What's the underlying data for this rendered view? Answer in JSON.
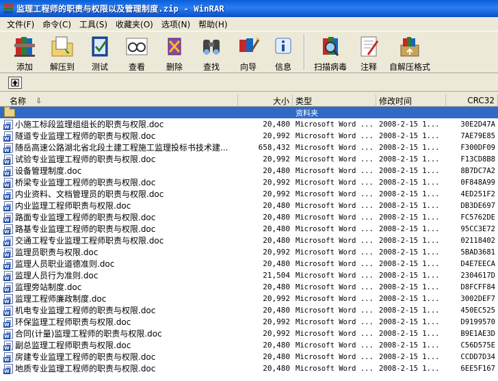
{
  "window": {
    "title": "监理工程师的职责与权限以及管理制度.zip - WinRAR"
  },
  "menu": [
    {
      "label": "文件(F)"
    },
    {
      "label": "命令(C)"
    },
    {
      "label": "工具(S)"
    },
    {
      "label": "收藏夹(O)"
    },
    {
      "label": "选项(N)"
    },
    {
      "label": "帮助(H)"
    }
  ],
  "toolbar": {
    "buttons": [
      {
        "label": "添加",
        "icon": "add-books-icon"
      },
      {
        "label": "解压到",
        "icon": "extract-folder-icon"
      },
      {
        "label": "测试",
        "icon": "test-check-icon"
      },
      {
        "label": "查看",
        "icon": "view-glasses-icon"
      },
      {
        "label": "删除",
        "icon": "delete-book-icon"
      },
      {
        "label": "查找",
        "icon": "find-binoculars-icon"
      },
      {
        "label": "向导",
        "icon": "wizard-icon"
      },
      {
        "label": "信息",
        "icon": "info-icon"
      },
      {
        "label": "扫描病毒",
        "icon": "virus-scan-icon"
      },
      {
        "label": "注释",
        "icon": "comment-icon"
      },
      {
        "label": "自解压格式",
        "icon": "sfx-icon"
      }
    ]
  },
  "columns": {
    "name": "名称",
    "size": "大小",
    "type": "类型",
    "date": "修改时间",
    "crc": "CRC32"
  },
  "folder_row": {
    "name": "..",
    "type": "资料夹"
  },
  "files": [
    {
      "name": "小施工标段监理组组长的职责与权限.doc",
      "size": "20,480",
      "type": "Microsoft Word ...",
      "date": "2008-2-15 1...",
      "crc": "30E2D47A"
    },
    {
      "name": "隧道专业监理工程师的职责与权限.doc",
      "size": "20,992",
      "type": "Microsoft Word ...",
      "date": "2008-2-15 1...",
      "crc": "7AE79E85"
    },
    {
      "name": "随岳高速公路湖北省北段土建工程施工监理投标书技术建...",
      "size": "658,432",
      "type": "Microsoft Word ...",
      "date": "2008-2-15 1...",
      "crc": "F300DF09"
    },
    {
      "name": "试验专业监理工程师的职责与权限.doc",
      "size": "20,992",
      "type": "Microsoft Word ...",
      "date": "2008-2-15 1...",
      "crc": "F13CD8B8"
    },
    {
      "name": "设备管理制度.doc",
      "size": "20,480",
      "type": "Microsoft Word ...",
      "date": "2008-2-15 1...",
      "crc": "8B7DC7A2"
    },
    {
      "name": "桥梁专业监理工程师的职责与权限.doc",
      "size": "20,992",
      "type": "Microsoft Word ...",
      "date": "2008-2-15 1...",
      "crc": "0F848A99"
    },
    {
      "name": "内业资料、文档管理员的职责与权限.doc",
      "size": "20,992",
      "type": "Microsoft Word ...",
      "date": "2008-2-15 1...",
      "crc": "4ED251F2"
    },
    {
      "name": "内业监理工程师职责与权限.doc",
      "size": "20,480",
      "type": "Microsoft Word ...",
      "date": "2008-2-15 1...",
      "crc": "DB3DE697"
    },
    {
      "name": "路面专业监理工程师的职责与权限.doc",
      "size": "20,480",
      "type": "Microsoft Word ...",
      "date": "2008-2-15 1...",
      "crc": "FC5762DE"
    },
    {
      "name": "路基专业监理工程师的职责与权限.doc",
      "size": "20,480",
      "type": "Microsoft Word ...",
      "date": "2008-2-15 1...",
      "crc": "95CC3E72"
    },
    {
      "name": "交通工程专业监理工程师职责与权限.doc",
      "size": "20,480",
      "type": "Microsoft Word ...",
      "date": "2008-2-15 1...",
      "crc": "02118402"
    },
    {
      "name": "监理员职责与权限.doc",
      "size": "20,992",
      "type": "Microsoft Word ...",
      "date": "2008-2-15 1...",
      "crc": "5BAD3681"
    },
    {
      "name": "监理人员职业道德准则.doc",
      "size": "20,480",
      "type": "Microsoft Word ...",
      "date": "2008-2-15 1...",
      "crc": "D4E7EECA"
    },
    {
      "name": "监理人员行为准则.doc",
      "size": "21,504",
      "type": "Microsoft Word ...",
      "date": "2008-2-15 1...",
      "crc": "2304617D"
    },
    {
      "name": "监理旁站制度.doc",
      "size": "20,480",
      "type": "Microsoft Word ...",
      "date": "2008-2-15 1...",
      "crc": "D8FCFF84"
    },
    {
      "name": "监理工程师廉政制度.doc",
      "size": "20,992",
      "type": "Microsoft Word ...",
      "date": "2008-2-15 1...",
      "crc": "3002DEF7"
    },
    {
      "name": "机电专业监理工程师的职责与权限.doc",
      "size": "20,480",
      "type": "Microsoft Word ...",
      "date": "2008-2-15 1...",
      "crc": "450EC525"
    },
    {
      "name": "环保监理工程师职责与权限.doc",
      "size": "20,992",
      "type": "Microsoft Word ...",
      "date": "2008-2-15 1...",
      "crc": "D9199570"
    },
    {
      "name": "合同(计量)监理工程师的职责与权限.doc",
      "size": "20,992",
      "type": "Microsoft Word ...",
      "date": "2008-2-15 1...",
      "crc": "B9E1AE3D"
    },
    {
      "name": "副总监理工程师职责与权限.doc",
      "size": "20,480",
      "type": "Microsoft Word ...",
      "date": "2008-2-15 1...",
      "crc": "C56D575E"
    },
    {
      "name": "房建专业监理工程师的职责与权限.doc",
      "size": "20,480",
      "type": "Microsoft Word ...",
      "date": "2008-2-15 1...",
      "crc": "CCDD7D34"
    },
    {
      "name": "地质专业监理工程师的职责与权限.doc",
      "size": "20,480",
      "type": "Microsoft Word ...",
      "date": "2008-2-15 1...",
      "crc": "6EE5F167"
    }
  ],
  "colors": {
    "titlebar": "#0a5fd8",
    "selection": "#316ac5",
    "chrome": "#ece9d8"
  }
}
